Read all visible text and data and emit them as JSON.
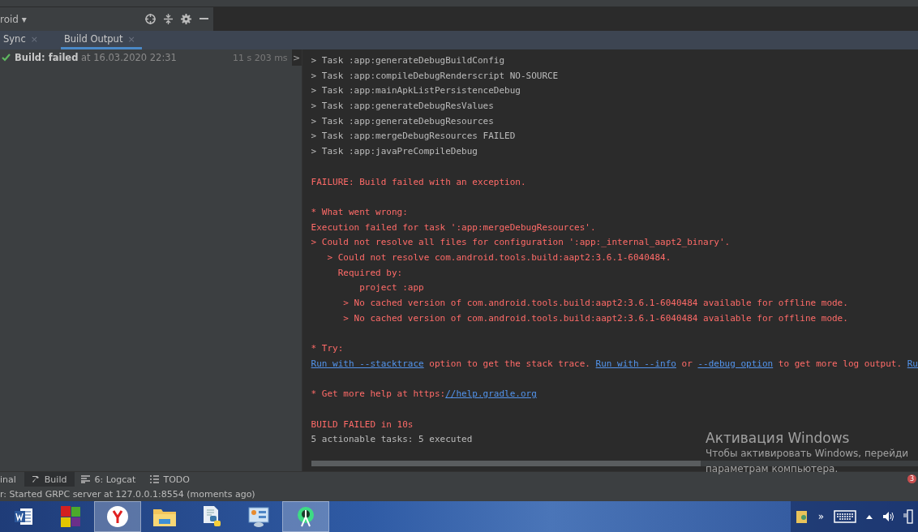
{
  "panel_header": {
    "title": "roid ▾"
  },
  "tabs": [
    {
      "label": "Sync",
      "close_mark": "×",
      "selected": false
    },
    {
      "label": "Build Output",
      "close_mark": "×",
      "selected": true
    }
  ],
  "build_tree": [
    {
      "label": "Build:",
      "status": "failed",
      "time_text": "at 16.03.2020 22:31",
      "duration": "11 s 203 ms",
      "expand_arrow": ">",
      "selected": true
    }
  ],
  "console": {
    "blocks": [
      {
        "lines": [
          {
            "error": false,
            "segments": [
              {
                "kind": "text",
                "text": "> Task :app:generateDebugBuildConfig"
              }
            ]
          },
          {
            "error": false,
            "segments": [
              {
                "kind": "text",
                "text": "> Task :app:compileDebugRenderscript NO-SOURCE"
              }
            ]
          },
          {
            "error": false,
            "segments": [
              {
                "kind": "text",
                "text": "> Task :app:mainApkListPersistenceDebug"
              }
            ]
          },
          {
            "error": false,
            "segments": [
              {
                "kind": "text",
                "text": "> Task :app:generateDebugResValues"
              }
            ]
          },
          {
            "error": false,
            "segments": [
              {
                "kind": "text",
                "text": "> Task :app:generateDebugResources"
              }
            ]
          },
          {
            "error": false,
            "segments": [
              {
                "kind": "text",
                "text": "> Task :app:mergeDebugResources FAILED"
              }
            ]
          },
          {
            "error": false,
            "segments": [
              {
                "kind": "text",
                "text": "> Task :app:javaPreCompileDebug"
              }
            ]
          }
        ]
      },
      {
        "lines": [
          {
            "error": true,
            "segments": [
              {
                "kind": "text",
                "text": "FAILURE: Build failed with an exception."
              }
            ]
          }
        ]
      },
      {
        "lines": [
          {
            "error": true,
            "segments": [
              {
                "kind": "text",
                "text": "* What went wrong:"
              }
            ]
          },
          {
            "error": true,
            "segments": [
              {
                "kind": "text",
                "text": "Execution failed for task ':app:mergeDebugResources'."
              }
            ]
          },
          {
            "error": true,
            "segments": [
              {
                "kind": "text",
                "text": "> Could not resolve all files for configuration ':app:_internal_aapt2_binary'."
              }
            ]
          },
          {
            "error": true,
            "segments": [
              {
                "kind": "text",
                "text": "   > Could not resolve com.android.tools.build:aapt2:3.6.1-6040484."
              }
            ]
          },
          {
            "error": true,
            "segments": [
              {
                "kind": "text",
                "text": "     Required by:"
              }
            ]
          },
          {
            "error": true,
            "segments": [
              {
                "kind": "text",
                "text": "         project :app"
              }
            ]
          },
          {
            "error": true,
            "segments": [
              {
                "kind": "text",
                "text": "      > No cached version of com.android.tools.build:aapt2:3.6.1-6040484 available for offline mode."
              }
            ]
          },
          {
            "error": true,
            "segments": [
              {
                "kind": "text",
                "text": "      > No cached version of com.android.tools.build:aapt2:3.6.1-6040484 available for offline mode."
              }
            ]
          }
        ]
      },
      {
        "lines": [
          {
            "error": true,
            "segments": [
              {
                "kind": "text",
                "text": "* Try:"
              }
            ]
          },
          {
            "error": true,
            "segments": [
              {
                "kind": "link",
                "text": "Run with --stacktrace"
              },
              {
                "kind": "text",
                "text": " option to get the stack trace. "
              },
              {
                "kind": "link",
                "text": "Run with --info"
              },
              {
                "kind": "text",
                "text": " or "
              },
              {
                "kind": "link",
                "text": "--debug option"
              },
              {
                "kind": "text",
                "text": " to get more log output. "
              },
              {
                "kind": "link",
                "text": "Ru"
              }
            ]
          }
        ]
      },
      {
        "lines": [
          {
            "error": true,
            "segments": [
              {
                "kind": "text",
                "text": "* Get more help at https:"
              },
              {
                "kind": "link",
                "text": "//help.gradle.org"
              }
            ]
          }
        ]
      },
      {
        "lines": [
          {
            "error": true,
            "segments": [
              {
                "kind": "text",
                "text": "BUILD FAILED in 10s"
              }
            ]
          },
          {
            "error": false,
            "segments": [
              {
                "kind": "text",
                "text": "5 actionable tasks: 5 executed"
              }
            ]
          }
        ]
      }
    ]
  },
  "tool_windows": [
    {
      "label": "inal",
      "kind": "plain",
      "selected": false
    },
    {
      "label": "Build",
      "kind": "hammer",
      "selected": true
    },
    {
      "label": "6: Logcat",
      "kind": "logcat",
      "selected": false
    },
    {
      "label": "TODO",
      "kind": "list",
      "selected": false
    }
  ],
  "notification_badge": "3",
  "status_bar": "r: Started GRPC server at 127.0.0.1:8554 (moments ago)",
  "activation": {
    "title": "Активация Windows",
    "lines": [
      "Чтобы активировать Windows, перейди",
      "параметрам компьютера."
    ]
  },
  "taskbar": {
    "apps": [
      {
        "kind": "word",
        "selected": false
      },
      {
        "kind": "tiles",
        "selected": false
      },
      {
        "kind": "yandex",
        "selected": true
      },
      {
        "kind": "explorer",
        "selected": false
      },
      {
        "kind": "python",
        "selected": false
      },
      {
        "kind": "control",
        "selected": false
      },
      {
        "kind": "android",
        "selected": true
      }
    ],
    "tray": {
      "overflow": "»"
    }
  }
}
